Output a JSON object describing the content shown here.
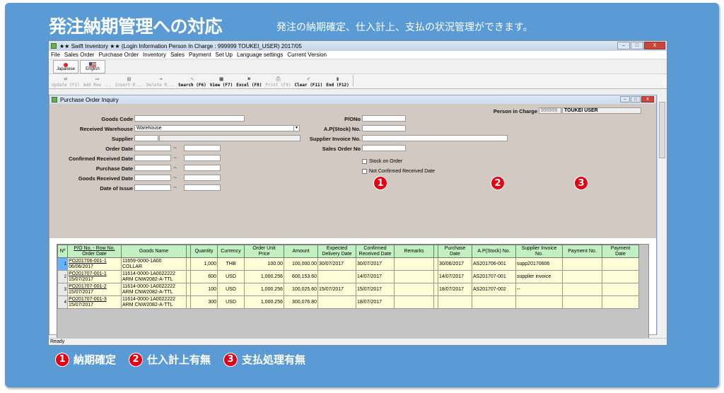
{
  "banner": {
    "title": "発注納期管理への対応",
    "subtitle": "発注の納期確定、仕入計上、支払の状況管理ができます。"
  },
  "window": {
    "title": "★★ Swift Inventory ★★ (Login Information  Person In Charge : 999999 TOUKEI_USER) 2017/05",
    "controls": [
      "–",
      "□",
      "X"
    ]
  },
  "menu": [
    "File",
    "Sales Order",
    "Purchase Order",
    "Inventory",
    "Sales",
    "Payment",
    "Set Up",
    "Language settings",
    "Current Version"
  ],
  "languages": [
    {
      "label": "Japanese",
      "icon": "flag-japan-icon"
    },
    {
      "label": "English",
      "icon": "flag-us-icon",
      "selected": true
    }
  ],
  "toolbar": [
    {
      "label": "Update (F1)",
      "icon": "update-icon",
      "enabled": false
    },
    {
      "label": "Add Row ...",
      "icon": "add-row-icon",
      "enabled": false
    },
    {
      "label": "Insert R...",
      "icon": "insert-row-icon",
      "enabled": false
    },
    {
      "label": "Delete R...",
      "icon": "delete-row-icon",
      "enabled": false
    },
    {
      "label": "Search (F6)",
      "icon": "search-icon",
      "enabled": true
    },
    {
      "label": "View (F7)",
      "icon": "view-icon",
      "enabled": true
    },
    {
      "label": "Excel (F8)",
      "icon": "excel-icon",
      "enabled": true
    },
    {
      "label": "Print (F9)",
      "icon": "print-icon",
      "enabled": false
    },
    {
      "label": "Clear (F11)",
      "icon": "clear-icon",
      "enabled": true
    },
    {
      "label": "End (F12)",
      "icon": "end-icon",
      "enabled": true
    }
  ],
  "inquiry": {
    "title": "Purchase Order Inquiry",
    "person_in_charge_label": "Person in Charge",
    "person_in_charge_code": "999999",
    "person_in_charge_name": "TOUKEI USER",
    "left_fields": {
      "goods_code": {
        "label": "Goods Code",
        "value": ""
      },
      "received_warehouse": {
        "label": "Received Warehouse",
        "value": "Warehouse"
      },
      "supplier": {
        "label": "Supplier",
        "value": ""
      },
      "order_date": {
        "label": "Order Date"
      },
      "confirmed_received_date": {
        "label": "Confirmed Received Date"
      },
      "purchase_date": {
        "label": "Purchase Date"
      },
      "goods_received_date": {
        "label": "Goods Received Date"
      },
      "date_of_issue": {
        "label": "Date of Issue"
      }
    },
    "range_sep": "~",
    "right_fields": {
      "po_no": {
        "label": "P/ONo",
        "value": ""
      },
      "ap_stock_no": {
        "label": "A.P(Stock) No.",
        "value": ""
      },
      "supplier_invoice_no": {
        "label": "Supplier Invoice No.",
        "value": ""
      },
      "sales_order_no": {
        "label": "Sales Order No",
        "value": ""
      }
    },
    "checkboxes": {
      "stock_on_order": "Stock on Order",
      "not_confirmed": "Not Confirmed Received Date"
    }
  },
  "grid": {
    "columns": {
      "no": "Nº",
      "po_row": [
        "P/O No. - Row No.",
        "Order Date"
      ],
      "goods_name": "Goods Name",
      "quantity": "Quantity",
      "currency": "Currency",
      "unit_price": [
        "Order Unit",
        "Price"
      ],
      "amount": "Amount",
      "expected": [
        "Expected",
        "Delivery Date"
      ],
      "confirmed": [
        "Confirmed",
        "Received Date"
      ],
      "remarks": "Remarks",
      "purchase_date": [
        "Purchase",
        "Date"
      ],
      "ap_no": "A.P(Stock) No.",
      "supplier_invoice": [
        "Supplier Invoice",
        "No."
      ],
      "payment_no": "Payment No.",
      "payment_date": [
        "Payment",
        "Date"
      ]
    },
    "rows": [
      {
        "no": "1",
        "po": "PO201706-001-1",
        "order_date": "06/06/2017",
        "goods1": "11659-0000-1A00",
        "goods2": "COLLAR",
        "qty": "1,000",
        "currency": "THB",
        "price": "100.00",
        "amount": "100,000.00",
        "expected": "30/07/2017",
        "confirmed": "30/07/2017",
        "remarks": "",
        "purchase_date": "30/06/2017",
        "ap_no": "AS201706-001",
        "supplier_invoice": "supp20170606",
        "payment_no": "",
        "payment_date": ""
      },
      {
        "no": "2",
        "po": "PO201707-001-1",
        "order_date": "15/07/2017",
        "goods1": "11614-0000-1A0022222",
        "goods2": "ARM CNW2082-A-TTL",
        "qty": "600",
        "currency": "USD",
        "price": "1,000.256",
        "amount": "600,153.60",
        "expected": "",
        "confirmed": "14/07/2017",
        "remarks": "",
        "purchase_date": "14/07/2017",
        "ap_no": "AS201707-001",
        "supplier_invoice": "supplier invoice",
        "payment_no": "",
        "payment_date": ""
      },
      {
        "no": "3",
        "po": "PO201707-001-2",
        "order_date": "15/07/2017",
        "goods1": "11614-0000-1A0022222",
        "goods2": "ARM CNW2082-A-TTL",
        "qty": "100",
        "currency": "USD",
        "price": "1,000.256",
        "amount": "100,025.60",
        "expected": "15/07/2017",
        "confirmed": "15/07/2017",
        "remarks": "",
        "purchase_date": "18/07/2017",
        "ap_no": "AS201707-002",
        "supplier_invoice": "--",
        "payment_no": "",
        "payment_date": ""
      },
      {
        "no": "4",
        "po": "PO201707-001-3",
        "order_date": "15/07/2017",
        "goods1": "11614-0000-1A0022222",
        "goods2": "ARM CNW2082-A-TTL",
        "qty": "300",
        "currency": "USD",
        "price": "1,000.256",
        "amount": "300,076.80",
        "expected": "",
        "confirmed": "18/07/2017",
        "remarks": "",
        "purchase_date": "",
        "ap_no": "",
        "supplier_invoice": "",
        "payment_no": "",
        "payment_date": ""
      }
    ]
  },
  "status": "Ready",
  "markers": [
    "1",
    "2",
    "3"
  ],
  "legend": [
    {
      "num": "1",
      "text": "納期確定"
    },
    {
      "num": "2",
      "text": "仕入計上有無"
    },
    {
      "num": "3",
      "text": "支払処理有無"
    }
  ],
  "colors": {
    "frame": "#5b9bd5",
    "marker": "#e60012",
    "grid_header": "#c3f0c3",
    "grid_cell": "#fffcd8",
    "form_bg": "#d3c9c3",
    "current_row": "#66b3ff"
  }
}
